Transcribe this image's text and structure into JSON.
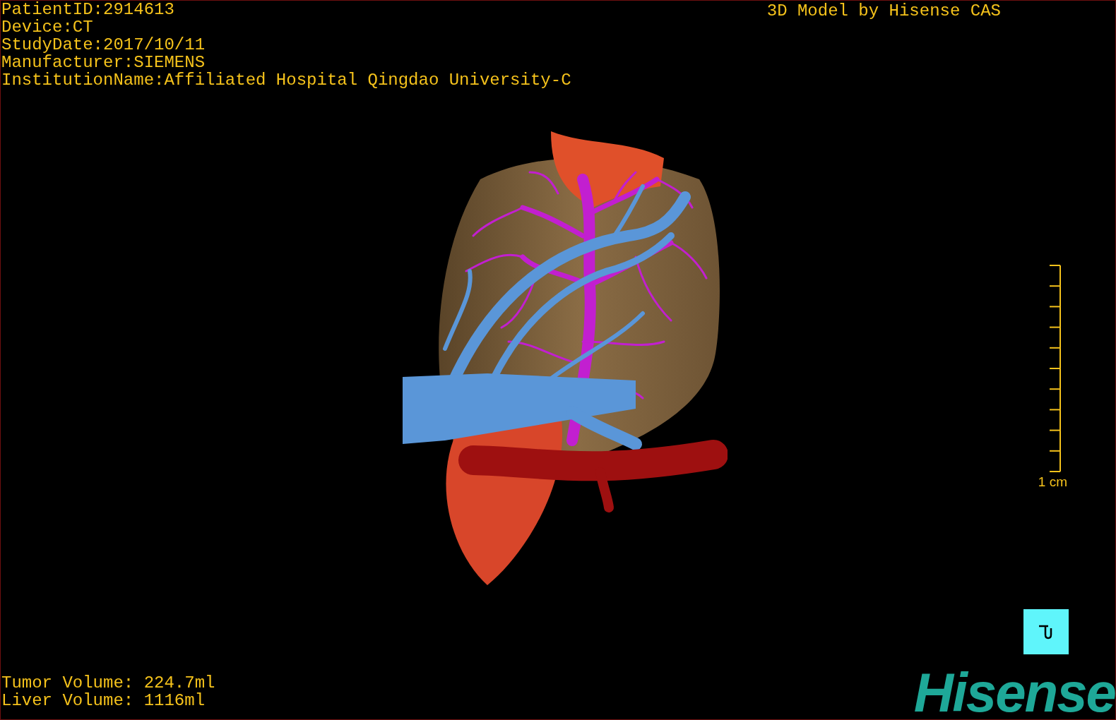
{
  "info_lines": [
    "PatientID:2914613",
    "Device:CT",
    "StudyDate:2017/10/11",
    "Manufacturer:SIEMENS",
    "InstitutionName:Affiliated Hospital Qingdao University-C"
  ],
  "title": "3D Model by Hisense CAS",
  "scale": {
    "label": "1 cm"
  },
  "volumes": [
    "Tumor Volume: 224.7ml",
    "Liver Volume: 1116ml"
  ],
  "logo": {
    "text": "Hisense"
  }
}
